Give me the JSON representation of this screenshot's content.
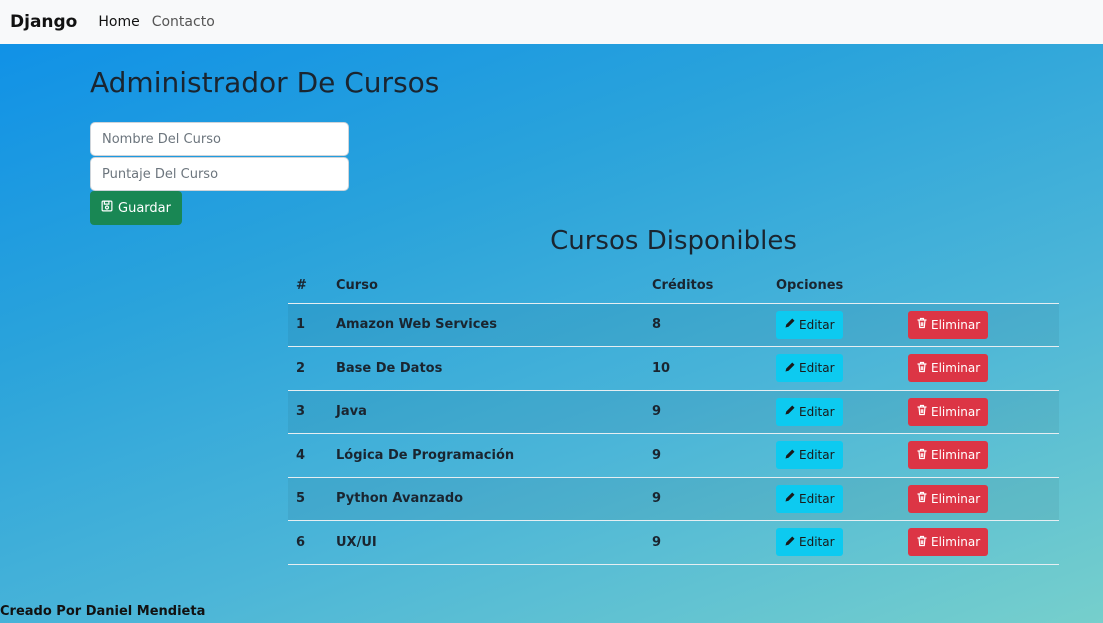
{
  "nav": {
    "brand": "Django",
    "links": [
      {
        "label": "Home"
      },
      {
        "label": "Contacto"
      }
    ]
  },
  "form": {
    "title": "Administrador De Cursos",
    "name_placeholder": "Nombre Del Curso",
    "score_placeholder": "Puntaje Del Curso",
    "save_label": "Guardar",
    "save_icon": "floppy-disk-icon"
  },
  "table": {
    "title": "Cursos Disponibles",
    "headers": [
      "#",
      "Curso",
      "Créditos",
      "Opciones"
    ],
    "edit_label": "Editar",
    "delete_label": "Eliminar",
    "edit_icon": "pencil-icon",
    "delete_icon": "trash-icon",
    "rows": [
      {
        "num": "1",
        "curso": "Amazon Web Services",
        "creditos": "8"
      },
      {
        "num": "2",
        "curso": "Base De Datos",
        "creditos": "10"
      },
      {
        "num": "3",
        "curso": "Java",
        "creditos": "9"
      },
      {
        "num": "4",
        "curso": "Lógica De Programación",
        "creditos": "9"
      },
      {
        "num": "5",
        "curso": "Python Avanzado",
        "creditos": "9"
      },
      {
        "num": "6",
        "curso": "UX/UI",
        "creditos": "9"
      }
    ]
  },
  "footer": {
    "text": "Creado Por Daniel Mendieta"
  },
  "colors": {
    "save": "#198754",
    "edit": "#0dcaf0",
    "delete": "#dc3545",
    "navbar": "#f8f9fa"
  }
}
